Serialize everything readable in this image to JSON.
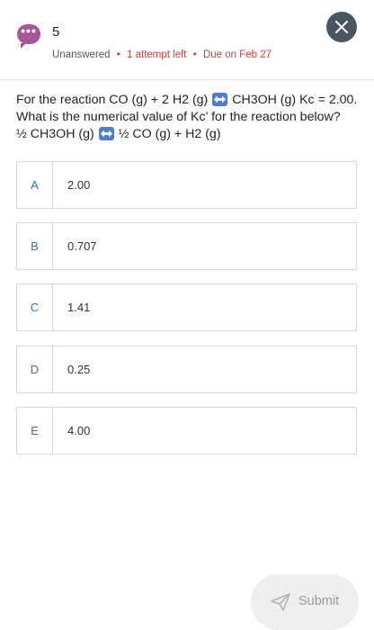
{
  "header": {
    "question_number": "5",
    "icon": "speech-bubble-icon",
    "icon_color": "#a9559a",
    "status": "Unanswered",
    "attempts": "1 attempt left",
    "due": "Due on Feb 27",
    "separator": "•",
    "close_icon": "close-icon"
  },
  "question": {
    "line1_a": "For the reaction CO (g) + 2 H2 (g)",
    "line1_b": "CH3OH (g) Kc = 2.00.",
    "line2": "What is the numerical value of Kc’ for the reaction below?",
    "line3_a": "½ CH3OH (g)",
    "line3_b": "½ CO (g) + H2 (g)",
    "arrow_icon": "left-right-arrow-icon",
    "arrow_color": "#4f7fc9"
  },
  "choices": [
    {
      "letter": "A",
      "text": "2.00"
    },
    {
      "letter": "B",
      "text": "0.707"
    },
    {
      "letter": "C",
      "text": "1.41"
    },
    {
      "letter": "D",
      "text": "0.25"
    },
    {
      "letter": "E",
      "text": "4.00"
    }
  ],
  "submit": {
    "label": "Submit",
    "icon": "paper-plane-icon"
  },
  "colors": {
    "accent_blue": "#3a6fb4",
    "alert_red": "#d33b3b",
    "close_bg": "#4a5560"
  }
}
